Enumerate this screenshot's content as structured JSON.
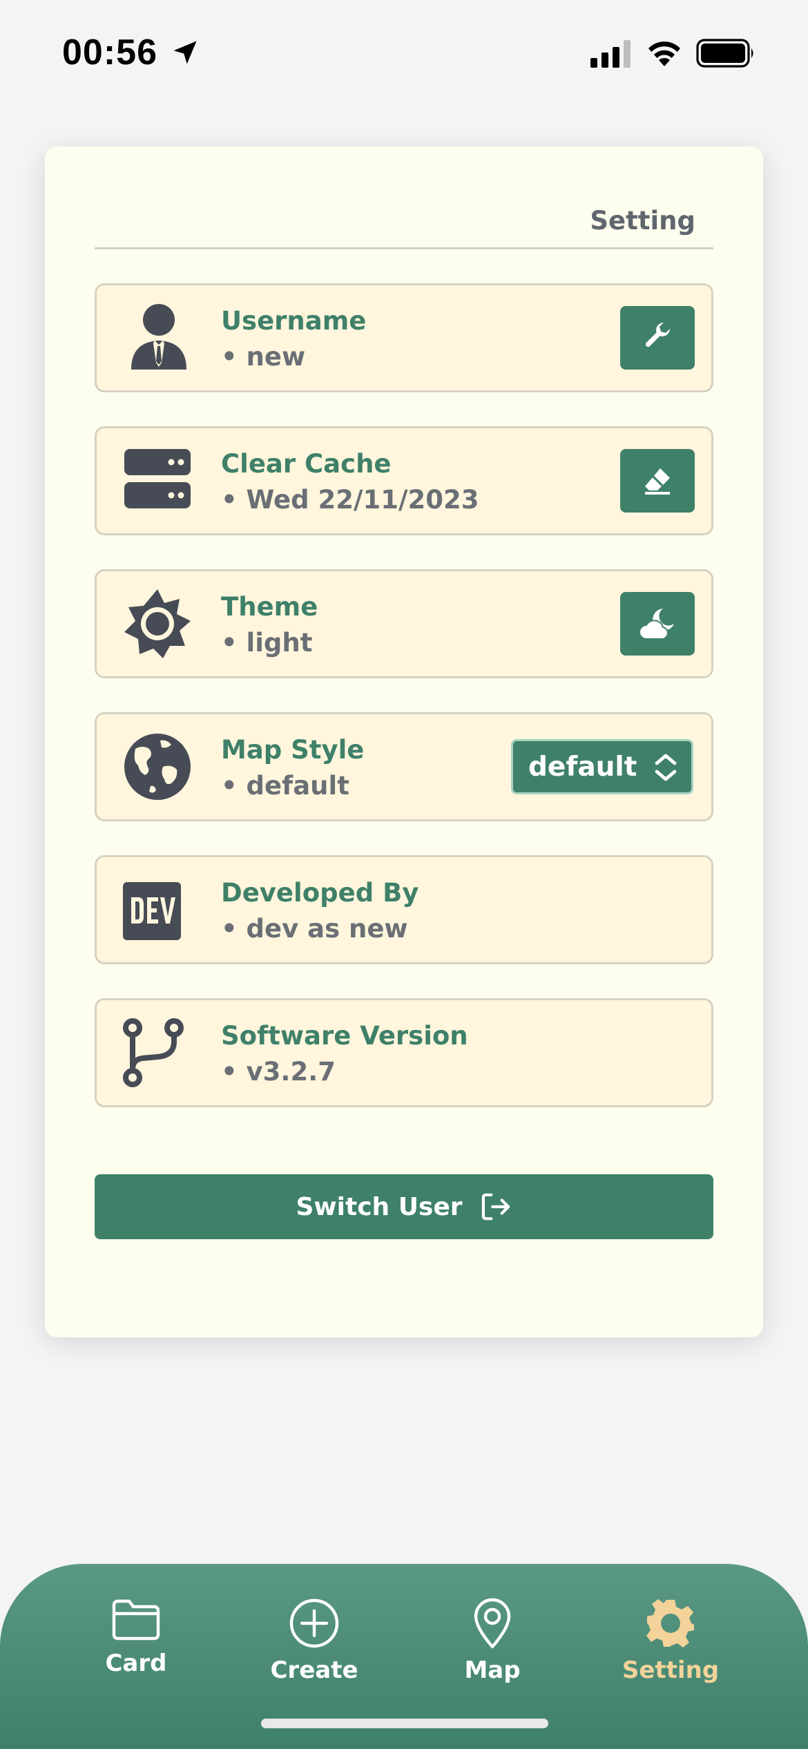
{
  "status_bar": {
    "time": "00:56"
  },
  "settings_card": {
    "title": "Setting",
    "rows": [
      {
        "label": "Username",
        "value": "• new",
        "icon": "user-tie-icon",
        "action_icon": "wrench-icon"
      },
      {
        "label": "Clear Cache",
        "value": "• Wed 22/11/2023",
        "icon": "server-icon",
        "action_icon": "eraser-icon"
      },
      {
        "label": "Theme",
        "value": "• light",
        "icon": "sun-icon",
        "action_icon": "cloud-moon-icon"
      },
      {
        "label": "Map Style",
        "value": "• default",
        "icon": "globe-icon",
        "select_value": "default"
      },
      {
        "label": "Developed By",
        "value": "• dev as new",
        "icon": "dev-icon"
      },
      {
        "label": "Software Version",
        "value": "• v3.2.7",
        "icon": "code-branch-icon"
      }
    ],
    "switch_user_label": "Switch User"
  },
  "tabbar": {
    "tabs": [
      {
        "label": "Card",
        "icon": "folder-icon"
      },
      {
        "label": "Create",
        "icon": "plus-circle-icon"
      },
      {
        "label": "Map",
        "icon": "map-pin-icon"
      },
      {
        "label": "Setting",
        "icon": "gear-icon",
        "active": true
      }
    ]
  },
  "colors": {
    "accent": "#3f8069",
    "row_bg": "#fff6dd",
    "card_bg": "#fefeef",
    "active_tab": "#f3d39a"
  }
}
